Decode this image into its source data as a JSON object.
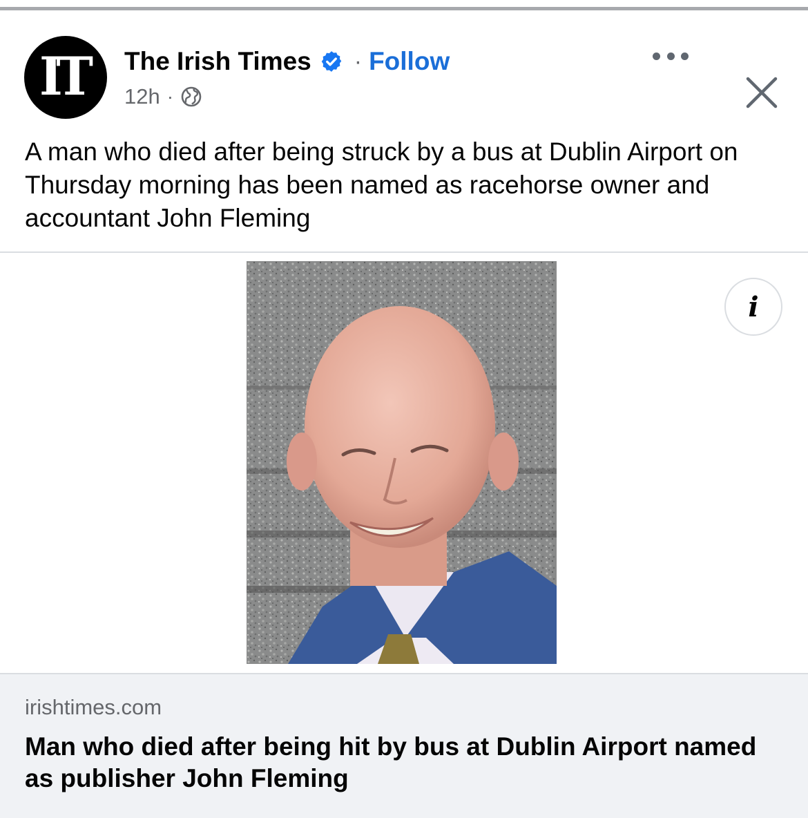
{
  "post": {
    "page_name": "The Irish Times",
    "avatar_text": "IT",
    "separator": "·",
    "follow_label": "Follow",
    "timestamp": "12h",
    "meta_separator": "·",
    "audience_icon": "globe-icon",
    "verified_icon": "verified-badge-icon",
    "more_icon": "more-options-icon",
    "close_icon": "close-icon",
    "caption": "A man who died after being struck by a bus at Dublin Airport on Thursday morning has been named as racehorse owner and accountant John Fleming"
  },
  "media": {
    "info_label": "i"
  },
  "link_preview": {
    "domain": "irishtimes.com",
    "headline": "Man who died after being hit by bus at Dublin Airport named as publisher John Fleming"
  },
  "colors": {
    "follow": "#1a6ed8",
    "verified": "#1877f2",
    "secondary_text": "#65676b",
    "card_background": "#f0f2f5"
  }
}
